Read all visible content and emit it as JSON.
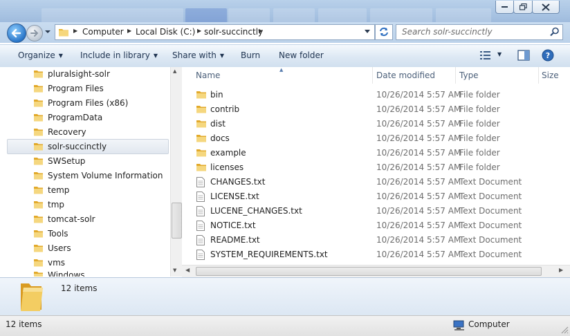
{
  "window": {
    "address_parts": [
      "Computer",
      "Local Disk (C:)",
      "solr-succinctly"
    ],
    "search_placeholder": "Search solr-succinctly"
  },
  "toolbar": {
    "organize": "Organize",
    "include_library": "Include in library",
    "share_with": "Share with",
    "burn": "Burn",
    "new_folder": "New folder"
  },
  "nav": {
    "items": [
      "pluralsight-solr",
      "Program Files",
      "Program Files (x86)",
      "ProgramData",
      "Recovery",
      "solr-succinctly",
      "SWSetup",
      "System Volume Information",
      "temp",
      "tmp",
      "tomcat-solr",
      "Tools",
      "Users",
      "vms",
      "Windows"
    ]
  },
  "columns": {
    "name": "Name",
    "date": "Date modified",
    "type": "Type",
    "size": "Size"
  },
  "files": [
    {
      "name": "bin",
      "date": "10/26/2014 5:57 AM",
      "type": "File folder",
      "kind": "folder"
    },
    {
      "name": "contrib",
      "date": "10/26/2014 5:57 AM",
      "type": "File folder",
      "kind": "folder"
    },
    {
      "name": "dist",
      "date": "10/26/2014 5:57 AM",
      "type": "File folder",
      "kind": "folder"
    },
    {
      "name": "docs",
      "date": "10/26/2014 5:57 AM",
      "type": "File folder",
      "kind": "folder"
    },
    {
      "name": "example",
      "date": "10/26/2014 5:57 AM",
      "type": "File folder",
      "kind": "folder"
    },
    {
      "name": "licenses",
      "date": "10/26/2014 5:57 AM",
      "type": "File folder",
      "kind": "folder"
    },
    {
      "name": "CHANGES.txt",
      "date": "10/26/2014 5:57 AM",
      "type": "Text Document",
      "kind": "text"
    },
    {
      "name": "LICENSE.txt",
      "date": "10/26/2014 5:57 AM",
      "type": "Text Document",
      "kind": "text"
    },
    {
      "name": "LUCENE_CHANGES.txt",
      "date": "10/26/2014 5:57 AM",
      "type": "Text Document",
      "kind": "text"
    },
    {
      "name": "NOTICE.txt",
      "date": "10/26/2014 5:57 AM",
      "type": "Text Document",
      "kind": "text"
    },
    {
      "name": "README.txt",
      "date": "10/26/2014 5:57 AM",
      "type": "Text Document",
      "kind": "text"
    },
    {
      "name": "SYSTEM_REQUIREMENTS.txt",
      "date": "10/26/2014 5:57 AM",
      "type": "Text Document",
      "kind": "text"
    }
  ],
  "details": {
    "count": "12 items"
  },
  "status": {
    "count": "12 items",
    "location": "Computer"
  }
}
